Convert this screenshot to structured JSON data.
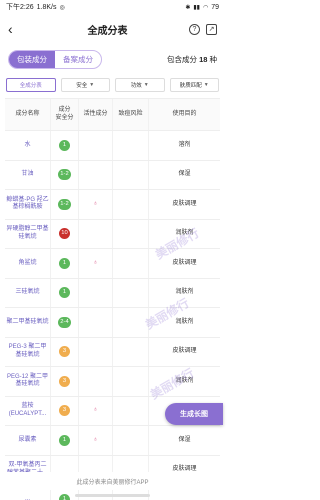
{
  "status_bar": {
    "time": "下午2:26",
    "speed": "1.8K/s",
    "battery": "79"
  },
  "app_bar": {
    "title": "全成分表"
  },
  "tabs": {
    "items": [
      "包装成分",
      "备案成分"
    ],
    "count_prefix": "包含成分",
    "count_value": "18",
    "count_suffix": "种"
  },
  "filters": [
    "全成分表",
    "安全",
    "功效",
    "肤质匹配"
  ],
  "table": {
    "headers": [
      "成分名称",
      "成分\n安全分",
      "活性成分",
      "致痘风险",
      "使用目的"
    ],
    "rows": [
      {
        "name": "水",
        "score": "1",
        "color": "#5cb85c",
        "active": false,
        "acne": "",
        "purpose": "溶剂"
      },
      {
        "name": "甘油",
        "score": "1-2",
        "color": "#5cb85c",
        "active": false,
        "acne": "",
        "purpose": "保湿"
      },
      {
        "name": "鲸蜡基-PG 羟乙基棕榈酰胺",
        "score": "1-2",
        "color": "#5cb85c",
        "active": true,
        "acne": "",
        "purpose": "皮肤调理"
      },
      {
        "name": "异硬脂醇二甲基硅氧烷",
        "score": "10",
        "color": "#c9302c",
        "active": false,
        "acne": "",
        "purpose": "润肤剂"
      },
      {
        "name": "角鲨烷",
        "score": "1",
        "color": "#5cb85c",
        "active": true,
        "acne": "",
        "purpose": "皮肤调理"
      },
      {
        "name": "三硅氧烷",
        "score": "1",
        "color": "#5cb85c",
        "active": false,
        "acne": "",
        "purpose": "润肤剂"
      },
      {
        "name": "聚二甲基硅氧烷",
        "score": "2-4",
        "color": "#5cb85c",
        "active": false,
        "acne": "",
        "purpose": "润肤剂"
      },
      {
        "name": "PEG-3 聚二甲基硅氧烷",
        "score": "3",
        "color": "#f0ad4e",
        "active": false,
        "acne": "",
        "purpose": "皮肤调理"
      },
      {
        "name": "PEG-12 聚二甲基硅氧烷",
        "score": "3",
        "color": "#f0ad4e",
        "active": false,
        "acne": "",
        "purpose": "润肤剂"
      },
      {
        "name": "蓝桉(EUCALYPT...",
        "score": "3",
        "color": "#f0ad4e",
        "active": true,
        "acne": "",
        "purpose": "皮肤调理"
      },
      {
        "name": "尿囊素",
        "score": "1",
        "color": "#5cb85c",
        "active": true,
        "acne": "",
        "purpose": "保湿"
      },
      {
        "name": "双-甲氧基丙二醇苯基聚二十...",
        "score": "",
        "color": "#5cb85c",
        "active": false,
        "acne": "",
        "purpose": "皮肤调理"
      },
      {
        "name": "...",
        "score": "1",
        "color": "#5cb85c",
        "active": false,
        "acne": "",
        "purpose": ""
      }
    ]
  },
  "float_button": "生成长图",
  "footer": "此成分表来自美丽修行APP",
  "watermark": "美丽修行"
}
